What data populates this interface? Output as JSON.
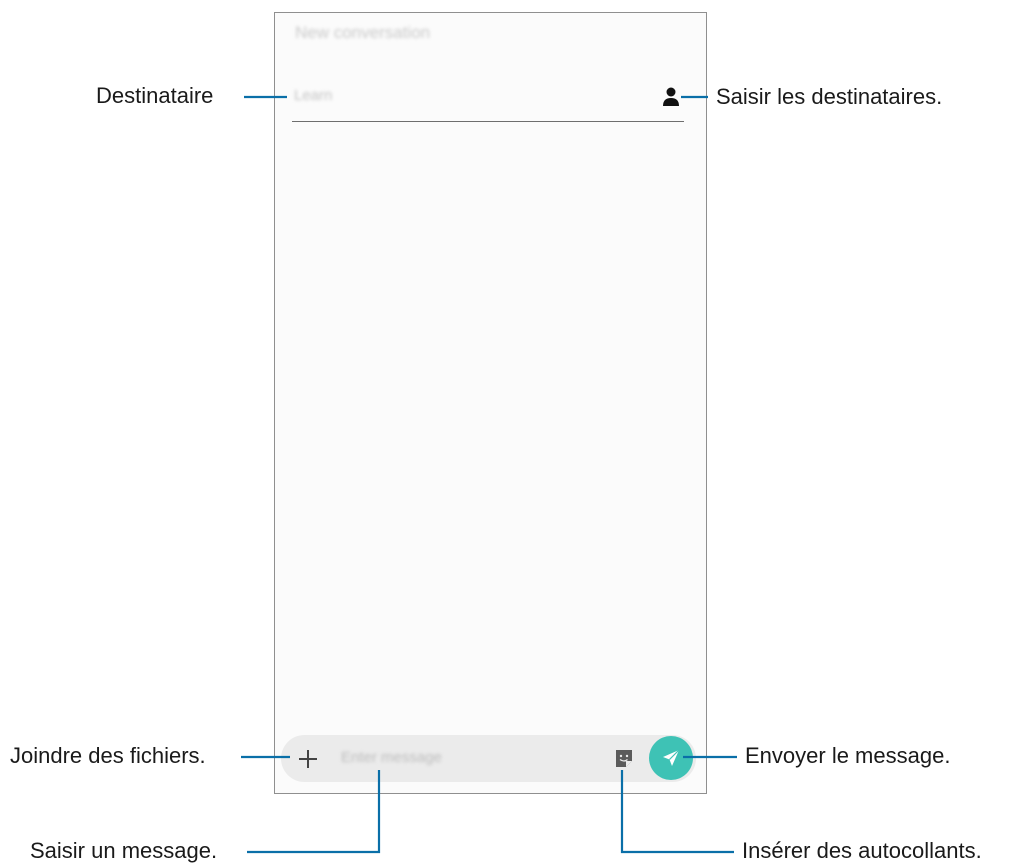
{
  "screen": {
    "title": "New conversation",
    "recipient_placeholder": "Learn",
    "message_placeholder": "Enter message",
    "send_color": "#3ec2b5"
  },
  "annotations": {
    "recipient": "Destinataire",
    "enter_recipients": "Saisir les destinataires.",
    "attach_files": "Joindre des fichiers.",
    "send_message": "Envoyer le message.",
    "enter_message": "Saisir un message.",
    "insert_stickers": "Insérer des autocollants."
  },
  "callout_color": "#0a6fa8",
  "icons": {
    "contact": "person-icon",
    "attach": "plus-icon",
    "sticker": "sticker-icon",
    "send": "paper-plane-icon"
  }
}
